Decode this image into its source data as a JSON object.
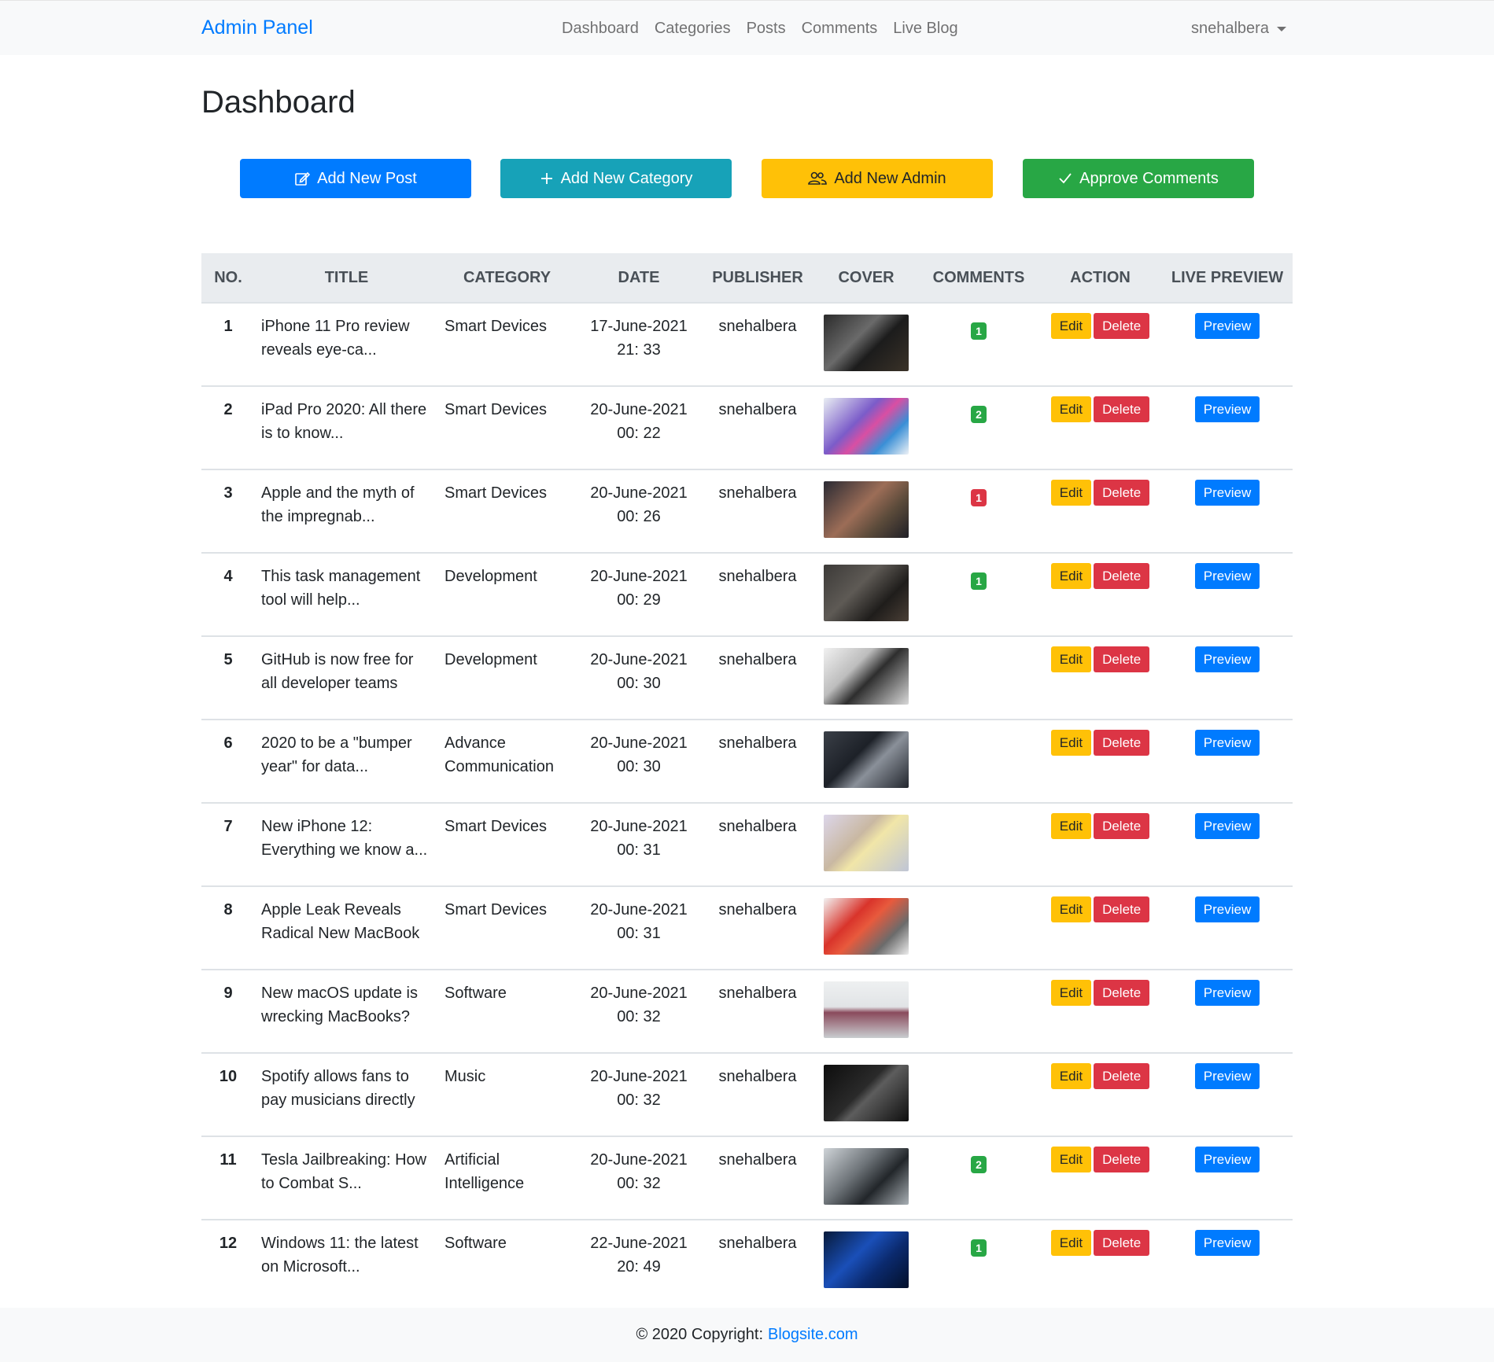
{
  "navbar": {
    "brand": "Admin Panel",
    "links": [
      "Dashboard",
      "Categories",
      "Posts",
      "Comments",
      "Live Blog"
    ],
    "user": "snehalbera"
  },
  "page": {
    "title": "Dashboard"
  },
  "actions": {
    "add_post": "Add New Post",
    "add_category": "Add New Category",
    "add_admin": "Add New Admin",
    "approve_comments": "Approve Comments"
  },
  "table": {
    "headers": [
      "NO.",
      "TITLE",
      "CATEGORY",
      "DATE",
      "PUBLISHER",
      "COVER",
      "COMMENTS",
      "ACTION",
      "LIVE PREVIEW"
    ],
    "edit_label": "Edit",
    "delete_label": "Delete",
    "preview_label": "Preview",
    "rows": [
      {
        "no": "1",
        "title": "iPhone 11 Pro review reveals eye-ca...",
        "category": "Smart Devices",
        "date": "17-June-2021",
        "time": "21: 33",
        "publisher": "snehalbera",
        "comments": "1",
        "comment_status": "success"
      },
      {
        "no": "2",
        "title": "iPad Pro 2020: All there is to know...",
        "category": "Smart Devices",
        "date": "20-June-2021",
        "time": "00: 22",
        "publisher": "snehalbera",
        "comments": "2",
        "comment_status": "success"
      },
      {
        "no": "3",
        "title": "Apple and the myth of the impregnab...",
        "category": "Smart Devices",
        "date": "20-June-2021",
        "time": "00: 26",
        "publisher": "snehalbera",
        "comments": "1",
        "comment_status": "danger"
      },
      {
        "no": "4",
        "title": "This task management tool will help...",
        "category": "Development",
        "date": "20-June-2021",
        "time": "00: 29",
        "publisher": "snehalbera",
        "comments": "1",
        "comment_status": "success"
      },
      {
        "no": "5",
        "title": "GitHub is now free for all developer teams",
        "category": "Development",
        "date": "20-June-2021",
        "time": "00: 30",
        "publisher": "snehalbera",
        "comments": "",
        "comment_status": ""
      },
      {
        "no": "6",
        "title": "2020 to be a \"bumper year\" for data...",
        "category": "Advance Communication",
        "date": "20-June-2021",
        "time": "00: 30",
        "publisher": "snehalbera",
        "comments": "",
        "comment_status": ""
      },
      {
        "no": "7",
        "title": "New iPhone 12: Everything we know a...",
        "category": "Smart Devices",
        "date": "20-June-2021",
        "time": "00: 31",
        "publisher": "snehalbera",
        "comments": "",
        "comment_status": ""
      },
      {
        "no": "8",
        "title": "Apple Leak Reveals Radical New MacBook",
        "category": "Smart Devices",
        "date": "20-June-2021",
        "time": "00: 31",
        "publisher": "snehalbera",
        "comments": "",
        "comment_status": ""
      },
      {
        "no": "9",
        "title": "New macOS update is wrecking MacBooks?",
        "category": "Software",
        "date": "20-June-2021",
        "time": "00: 32",
        "publisher": "snehalbera",
        "comments": "",
        "comment_status": ""
      },
      {
        "no": "10",
        "title": "Spotify allows fans to pay musicians directly",
        "category": "Music",
        "date": "20-June-2021",
        "time": "00: 32",
        "publisher": "snehalbera",
        "comments": "",
        "comment_status": ""
      },
      {
        "no": "11",
        "title": "Tesla Jailbreaking: How to Combat S...",
        "category": "Artificial Intelligence",
        "date": "20-June-2021",
        "time": "00: 32",
        "publisher": "snehalbera",
        "comments": "2",
        "comment_status": "success"
      },
      {
        "no": "12",
        "title": "Windows 11: the latest on Microsoft...",
        "category": "Software",
        "date": "22-June-2021",
        "time": "20: 49",
        "publisher": "snehalbera",
        "comments": "1",
        "comment_status": "success"
      }
    ]
  },
  "footer": {
    "text": "© 2020 Copyright:",
    "link": "Blogsite.com"
  },
  "colors": {
    "primary": "#007bff",
    "info": "#17a2b8",
    "warning": "#ffc107",
    "success": "#28a745",
    "danger": "#dc3545",
    "table_head": "#e9ecef"
  }
}
